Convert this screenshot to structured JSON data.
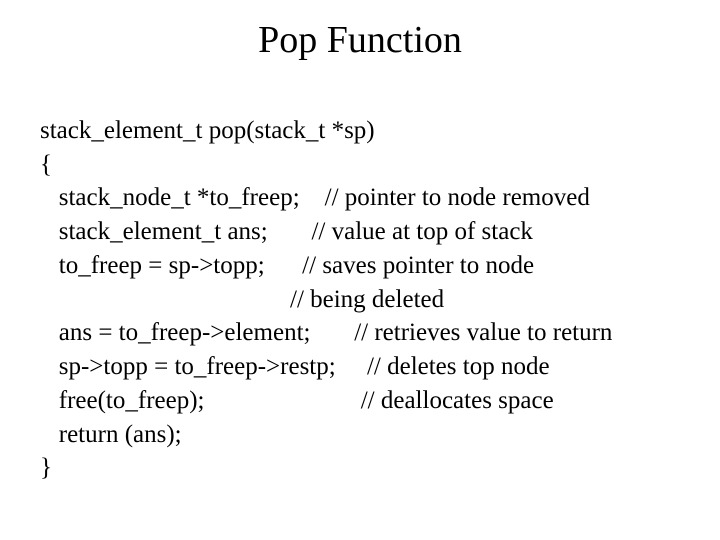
{
  "title": "Pop Function",
  "code": {
    "l1": "stack_element_t pop(stack_t *sp)",
    "l2": "{",
    "l3": "   stack_node_t *to_freep;    // pointer to node removed",
    "l4": "   stack_element_t ans;       // value at top of stack",
    "l5": "   to_freep = sp->topp;      // saves pointer to node",
    "l6": "                                        // being deleted",
    "l7": "   ans = to_freep->element;       // retrieves value to return",
    "l8": "   sp->topp = to_freep->restp;     // deletes top node",
    "l9": "   free(to_freep);                         // deallocates space",
    "l10": "   return (ans);",
    "l11": "}"
  }
}
